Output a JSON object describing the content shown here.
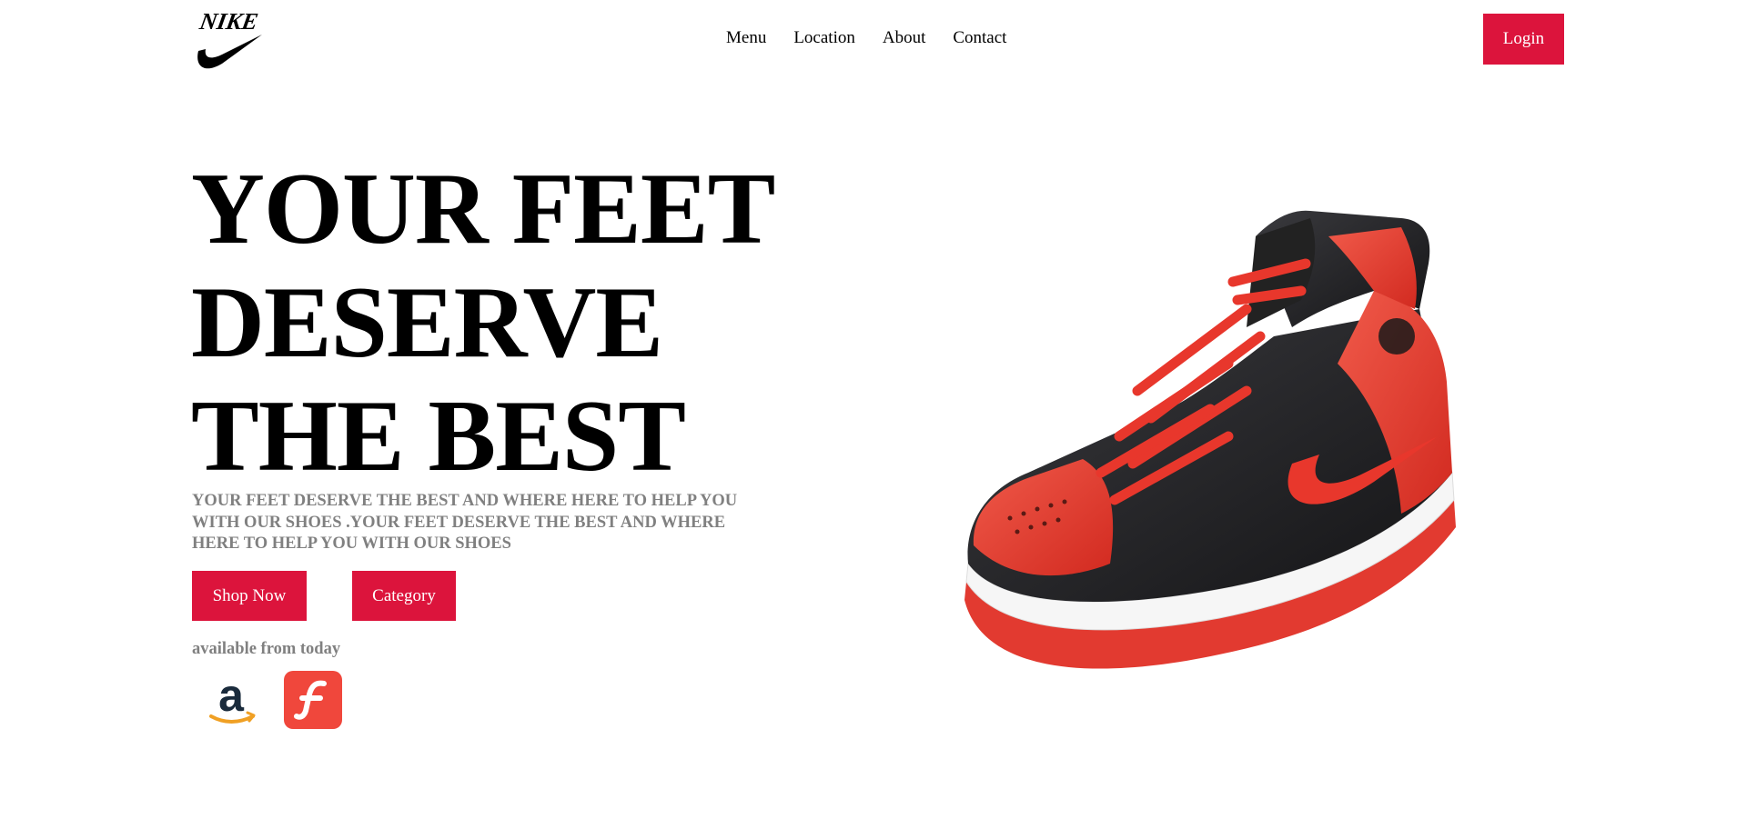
{
  "brand": {
    "logo_text": "NIKE",
    "logo_icon": "nike-swoosh-icon"
  },
  "nav": {
    "items": [
      "Menu",
      "Location",
      "About",
      "Contact"
    ]
  },
  "header": {
    "login_label": "Login"
  },
  "hero": {
    "title_lines": [
      "YOUR FEET",
      "DESERVE",
      "THE BEST"
    ],
    "subtitle": "YOUR FEET DESERVE THE BEST AND WHERE HERE TO HELP YOU WITH OUR SHOES .YOUR FEET DESERVE THE BEST AND WHERE HERE TO HELP YOU WITH OUR SHOES",
    "shop_label": "Shop Now",
    "category_label": "Category",
    "available_text": "available from today",
    "stores": [
      {
        "name": "amazon",
        "icon": "amazon-icon"
      },
      {
        "name": "flipkart",
        "icon": "flipkart-icon"
      }
    ],
    "product_image": "red-black-high-top-sneaker"
  },
  "colors": {
    "accent": "#dc143c",
    "muted_text": "#808080",
    "shoe_red": "#e53a2f",
    "shoe_black": "#1c1c1e"
  }
}
